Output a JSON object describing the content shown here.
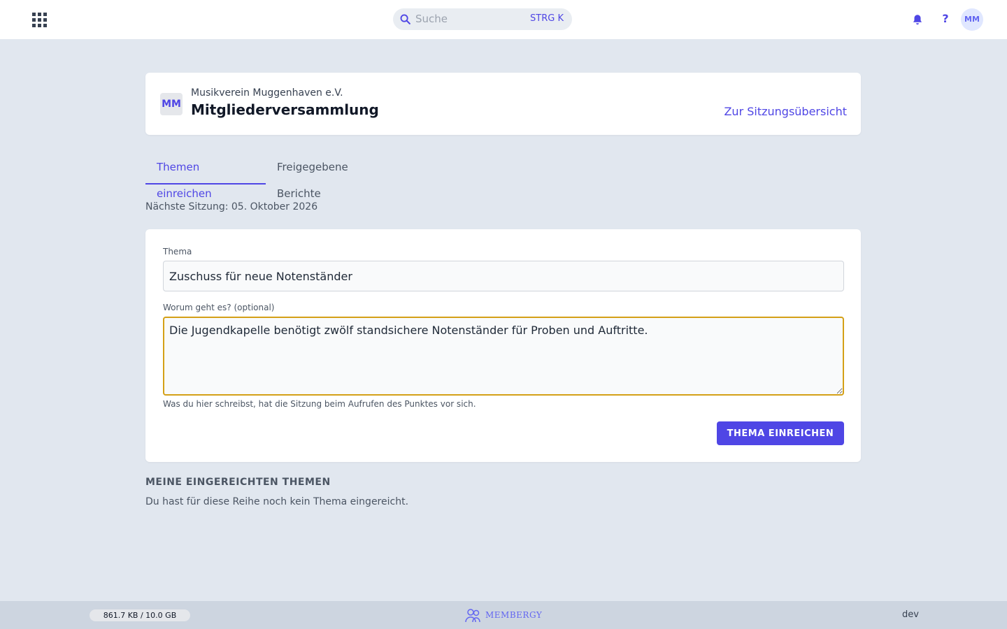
{
  "topbar": {
    "search_placeholder": "Suche",
    "search_shortcut": "STRG K",
    "help_label": "?",
    "avatar_initials": "MM",
    "icons": [
      "apps-grid-icon",
      "search-icon",
      "bell-icon"
    ]
  },
  "header": {
    "org_badge": "MM",
    "org_name": "Musikverein Muggenhaven e.V.",
    "meeting_title": "Mitgliederversammlung",
    "overview_link": "Zur Sitzungsübersicht"
  },
  "tabs": [
    {
      "label": "Themen einreichen",
      "active": true
    },
    {
      "label": "Freigegebene Berichte",
      "active": false
    }
  ],
  "next_session": "Nächste Sitzung: 05. Oktober 2026",
  "form": {
    "topic_label": "Thema",
    "topic_value": "Zuschuss für neue Notenständer",
    "description_label": "Worum geht es? (optional)",
    "description_value": "Die Jugendkapelle benötigt zwölf standsichere Notenständer für Proben und Auftritte.",
    "hint": "Was du hier schreibst, hat die Sitzung beim Aufrufen des Punktes vor sich.",
    "submit_label": "THEMA EINREICHEN"
  },
  "my_topics": {
    "title": "MEINE EINGEREICHTEN THEMEN",
    "empty_text": "Du hast für diese Reihe noch kein Thema eingereicht."
  },
  "footer": {
    "storage_text": "861.7 KB / 10.0 GB",
    "storage_used_fraction": 0.0001,
    "brand": "MEMBERGY",
    "env": "dev"
  },
  "colors": {
    "accent": "#4f46e5",
    "focus_border": "#d4a017",
    "background": "#e1e7ef"
  }
}
